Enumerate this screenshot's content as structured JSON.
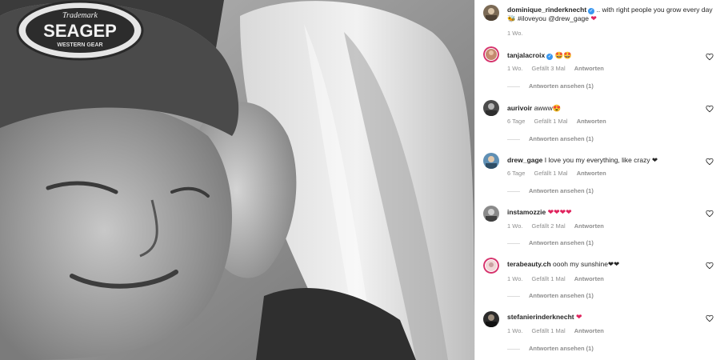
{
  "post": {
    "author": "dominique_rinderknecht",
    "caption_line1": ".. with right people you grow every day",
    "caption_line2_emoji": "🐝",
    "caption_line2_text": "#iloveyou @drew_gage",
    "caption_heart": "❤",
    "time": "1 Wo."
  },
  "comments": [
    {
      "username": "tanjalacroix",
      "verified": true,
      "text": "🤩🤩",
      "time": "1 Wo.",
      "likes": "Gefällt 3 Mal",
      "reply_label": "Antworten",
      "replies_label": "Antworten ansehen (1)"
    },
    {
      "username": "aurivoir",
      "verified": false,
      "text": "awww😍",
      "time": "6 Tage",
      "likes": "Gefällt 1 Mal",
      "reply_label": "Antworten",
      "replies_label": "Antworten ansehen (1)"
    },
    {
      "username": "drew_gage",
      "verified": false,
      "text": "I love you my everything, like crazy ❤",
      "time": "6 Tage",
      "likes": "Gefällt 1 Mal",
      "reply_label": "Antworten",
      "replies_label": "Antworten ansehen (1)"
    },
    {
      "username": "instamozzie",
      "verified": false,
      "text": "❤❤❤❤",
      "time": "1 Wo.",
      "likes": "Gefällt 2 Mal",
      "reply_label": "Antworten",
      "replies_label": "Antworten ansehen (1)"
    },
    {
      "username": "terabeauty.ch",
      "verified": false,
      "text": "oooh my sunshine❤❤",
      "time": "1 Wo.",
      "likes": "Gefällt 1 Mal",
      "reply_label": "Antworten",
      "replies_label": "Antworten ansehen (1)"
    },
    {
      "username": "stefanierinderknecht",
      "verified": false,
      "text": "❤",
      "time": "1 Wo.",
      "likes": "Gefällt 1 Mal",
      "reply_label": "Antworten",
      "replies_label": "Antworten ansehen (1)"
    }
  ],
  "photo": {
    "cap_text_top": "Trademark",
    "cap_text_main": "SEAGEP",
    "cap_text_bottom": "WESTERN GEAR"
  },
  "colors": {
    "heart": "#e0245e",
    "verified": "#3897f0",
    "meta_text": "#8e8e8e"
  }
}
